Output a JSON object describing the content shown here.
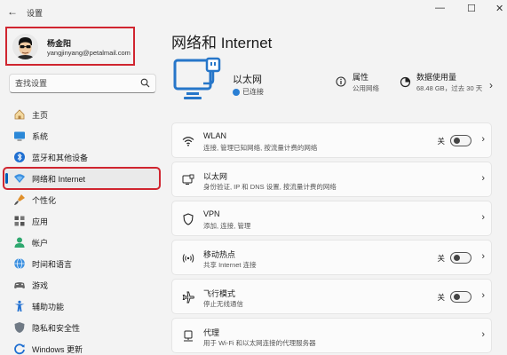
{
  "window": {
    "title": "设置",
    "back": "←",
    "minimize": "—",
    "maximize": "☐",
    "close": "✕"
  },
  "profile": {
    "name": "杨金阳",
    "email": "yangjinyang@petalmail.com"
  },
  "search": {
    "placeholder": "查找设置"
  },
  "sidebar": {
    "items": [
      {
        "label": "主页",
        "icon": "home-icon"
      },
      {
        "label": "系统",
        "icon": "monitor-icon"
      },
      {
        "label": "蓝牙和其他设备",
        "icon": "bluetooth-icon"
      },
      {
        "label": "网络和 Internet",
        "icon": "wifi-icon",
        "active": true
      },
      {
        "label": "个性化",
        "icon": "brush-icon"
      },
      {
        "label": "应用",
        "icon": "apps-icon"
      },
      {
        "label": "帐户",
        "icon": "person-icon"
      },
      {
        "label": "时间和语言",
        "icon": "globe-icon"
      },
      {
        "label": "游戏",
        "icon": "gamepad-icon"
      },
      {
        "label": "辅助功能",
        "icon": "accessibility-icon"
      },
      {
        "label": "隐私和安全性",
        "icon": "shield-icon"
      },
      {
        "label": "Windows 更新",
        "icon": "update-icon"
      }
    ]
  },
  "main": {
    "title": "网络和 Internet",
    "hero": {
      "name": "以太网",
      "status": "已连接",
      "properties_title": "属性",
      "properties_sub": "公用网络",
      "usage_title": "数据使用量",
      "usage_sub": "68.48 GB，过去 30 天",
      "chevron": "›"
    },
    "cards": [
      {
        "title": "WLAN",
        "sub": "连接, 管理已知网络, 按流量计费的网络",
        "state": "关",
        "toggle": false,
        "icon": "wifi-icon"
      },
      {
        "title": "以太网",
        "sub": "身份验证, IP 和 DNS 设置, 按流量计费的网络",
        "icon": "ethernet-icon"
      },
      {
        "title": "VPN",
        "sub": "添加, 连接, 管理",
        "icon": "vpn-shield-icon"
      },
      {
        "title": "移动热点",
        "sub": "共享 Internet 连接",
        "state": "关",
        "toggle": false,
        "icon": "hotspot-icon"
      },
      {
        "title": "飞行模式",
        "sub": "停止无线通信",
        "state": "关",
        "toggle": false,
        "icon": "airplane-icon"
      },
      {
        "title": "代理",
        "sub": "用于 Wi-Fi 和以太网连接的代理服务器",
        "icon": "proxy-icon"
      }
    ],
    "chevron": "›"
  },
  "colors": {
    "accent": "#005fb8",
    "highlight_border": "#d0252f",
    "background": "#f3f3f3",
    "card": "#fbfbfb"
  }
}
